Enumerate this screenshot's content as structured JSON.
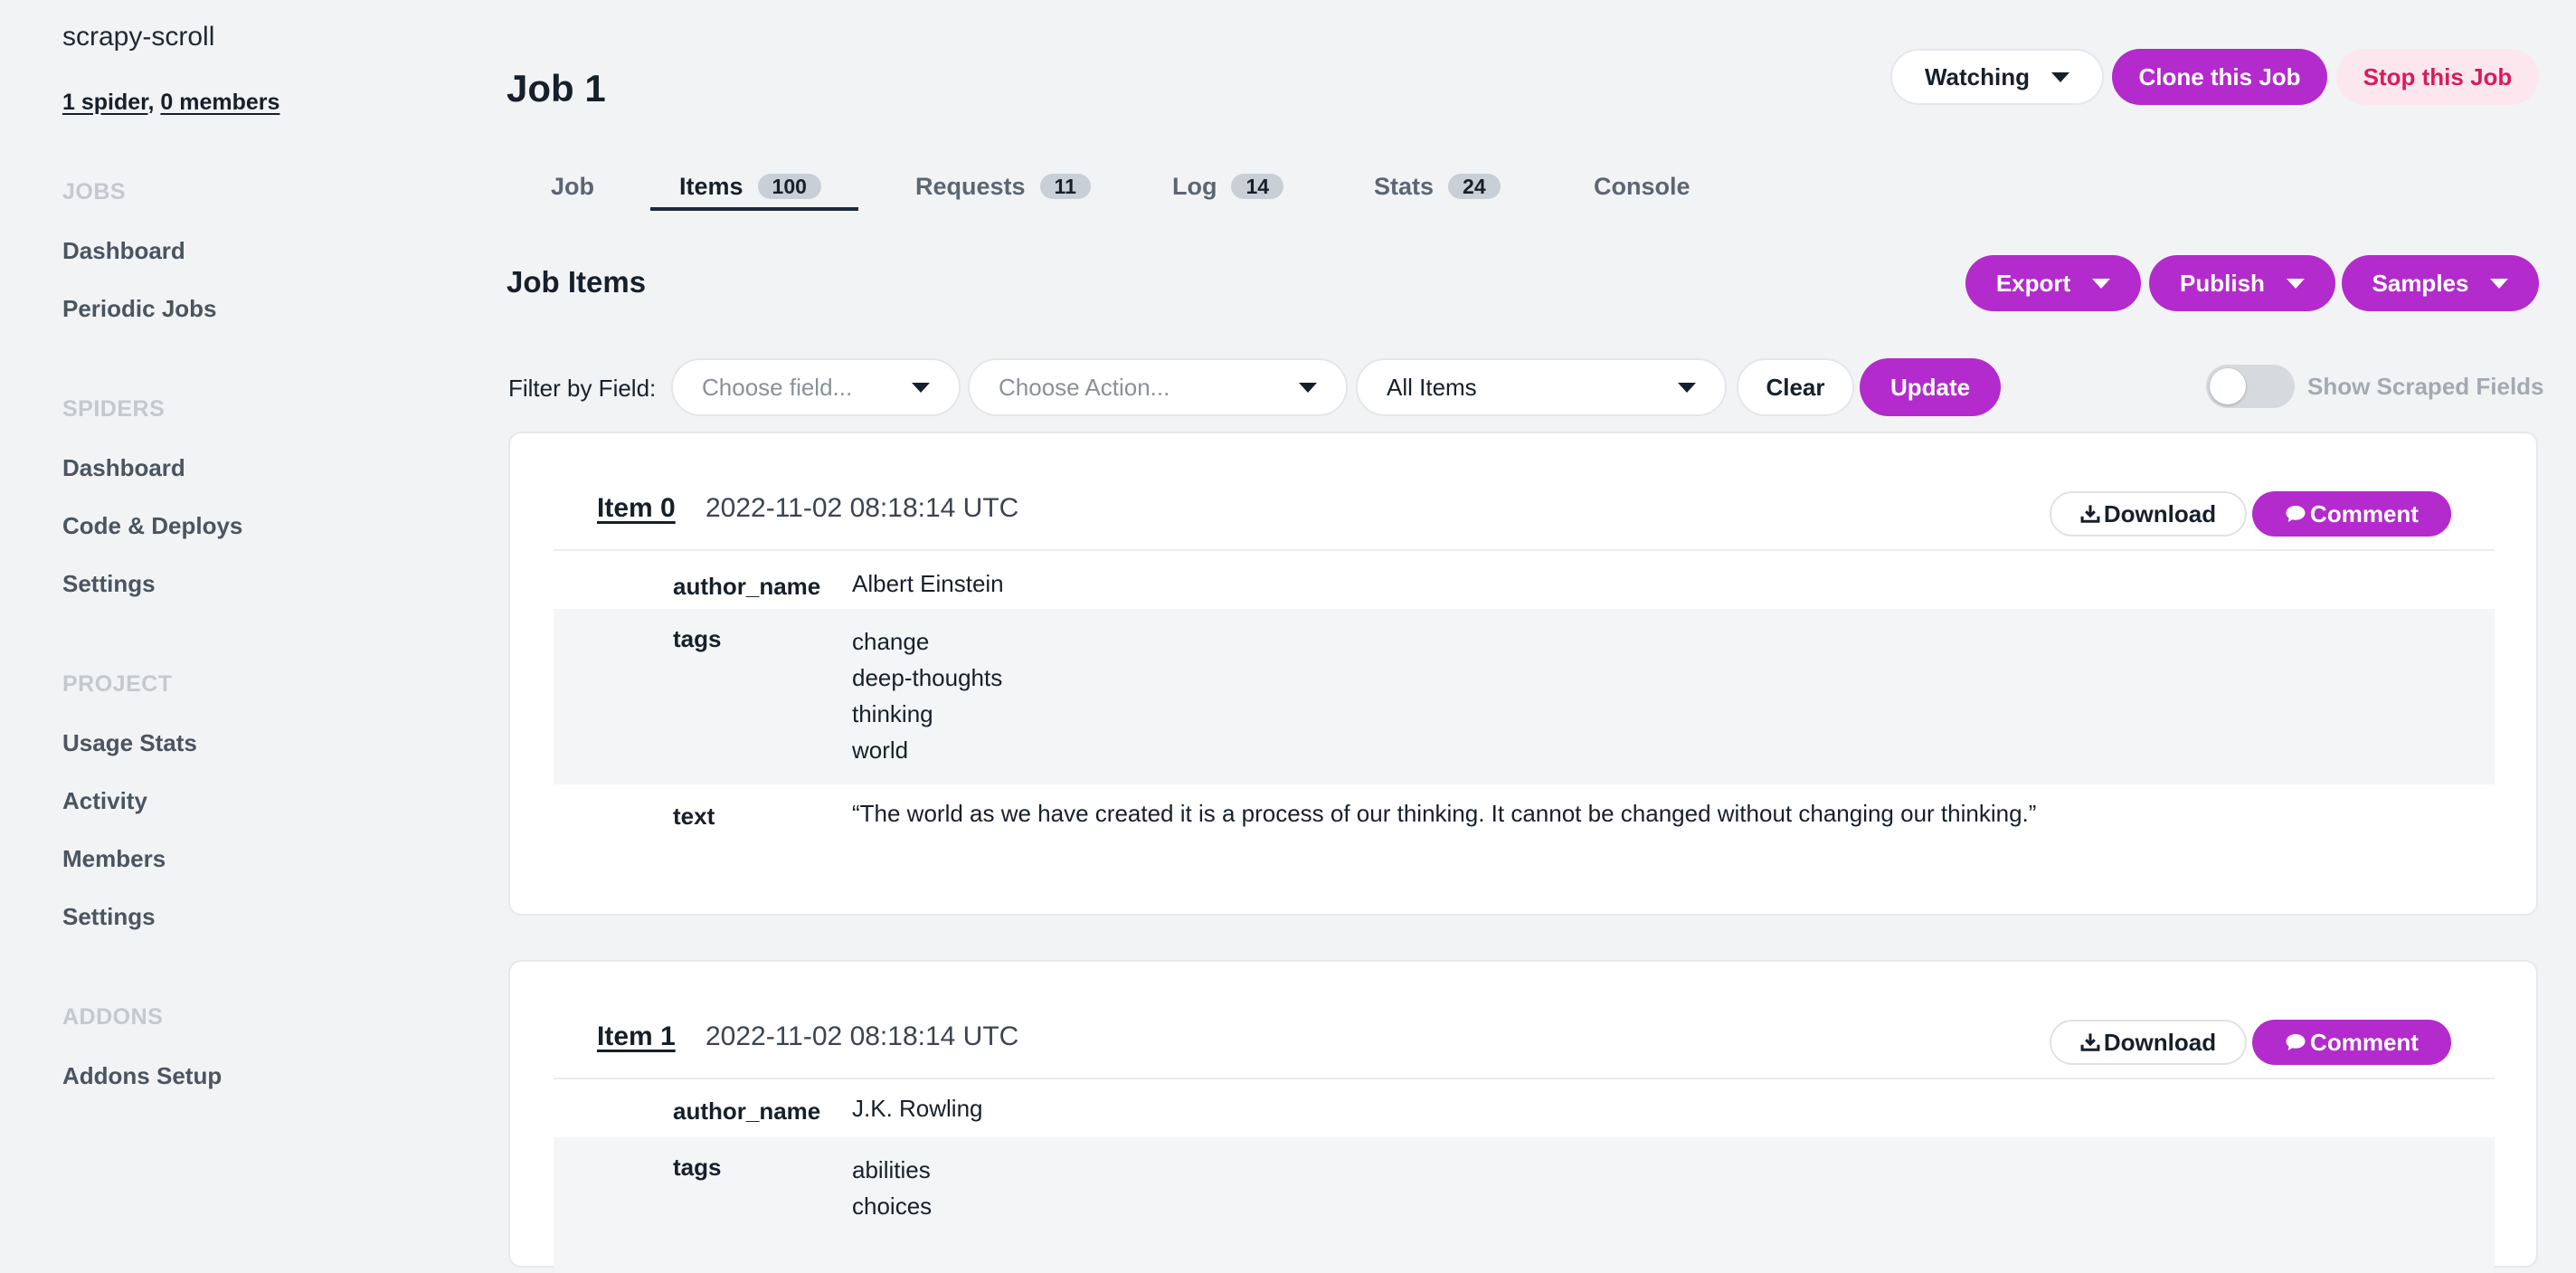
{
  "sidebar": {
    "project_name": "scrapy-scroll",
    "spiders_link": "1 spider",
    "separator": ",",
    "members_link": "0 members",
    "sections": [
      {
        "title": "JOBS",
        "items": [
          "Dashboard",
          "Periodic Jobs"
        ]
      },
      {
        "title": "SPIDERS",
        "items": [
          "Dashboard",
          "Code & Deploys",
          "Settings"
        ]
      },
      {
        "title": "PROJECT",
        "items": [
          "Usage Stats",
          "Activity",
          "Members",
          "Settings"
        ]
      },
      {
        "title": "ADDONS",
        "items": [
          "Addons Setup"
        ]
      }
    ]
  },
  "header": {
    "title": "Job 1",
    "watching_label": "Watching",
    "clone_label": "Clone this Job",
    "stop_label": "Stop this Job"
  },
  "tabs": [
    {
      "label": "Job",
      "count": null
    },
    {
      "label": "Items",
      "count": "100"
    },
    {
      "label": "Requests",
      "count": "11"
    },
    {
      "label": "Log",
      "count": "14"
    },
    {
      "label": "Stats",
      "count": "24"
    },
    {
      "label": "Console",
      "count": null
    }
  ],
  "section": {
    "title": "Job Items",
    "export_label": "Export",
    "publish_label": "Publish",
    "samples_label": "Samples"
  },
  "filter": {
    "label": "Filter by Field:",
    "field_placeholder": "Choose field...",
    "action_placeholder": "Choose Action...",
    "items_value": "All Items",
    "clear_label": "Clear",
    "update_label": "Update",
    "toggle_label": "Show Scraped Fields",
    "toggle_on": false
  },
  "items": [
    {
      "link": "Item 0",
      "timestamp": "2022-11-02 08:18:14 UTC",
      "download_label": "Download",
      "comment_label": "Comment",
      "author_key": "author_name",
      "author": "Albert Einstein",
      "tags_key": "tags",
      "tags": [
        "change",
        "deep-thoughts",
        "thinking",
        "world"
      ],
      "text_key": "text",
      "text": "“The world as we have created it is a process of our thinking. It cannot be changed without changing our thinking.”"
    },
    {
      "link": "Item 1",
      "timestamp": "2022-11-02 08:18:14 UTC",
      "download_label": "Download",
      "comment_label": "Comment",
      "author_key": "author_name",
      "author": "J.K. Rowling",
      "tags_key": "tags",
      "tags": [
        "abilities",
        "choices"
      ]
    }
  ],
  "colors": {
    "accent": "#b32bcc",
    "stop_bg": "#fde7ef",
    "stop_text": "#d81b5c",
    "page_bg": "#f2f3f5"
  },
  "icons": [
    "caret-down-icon",
    "download-icon",
    "comment-icon"
  ]
}
